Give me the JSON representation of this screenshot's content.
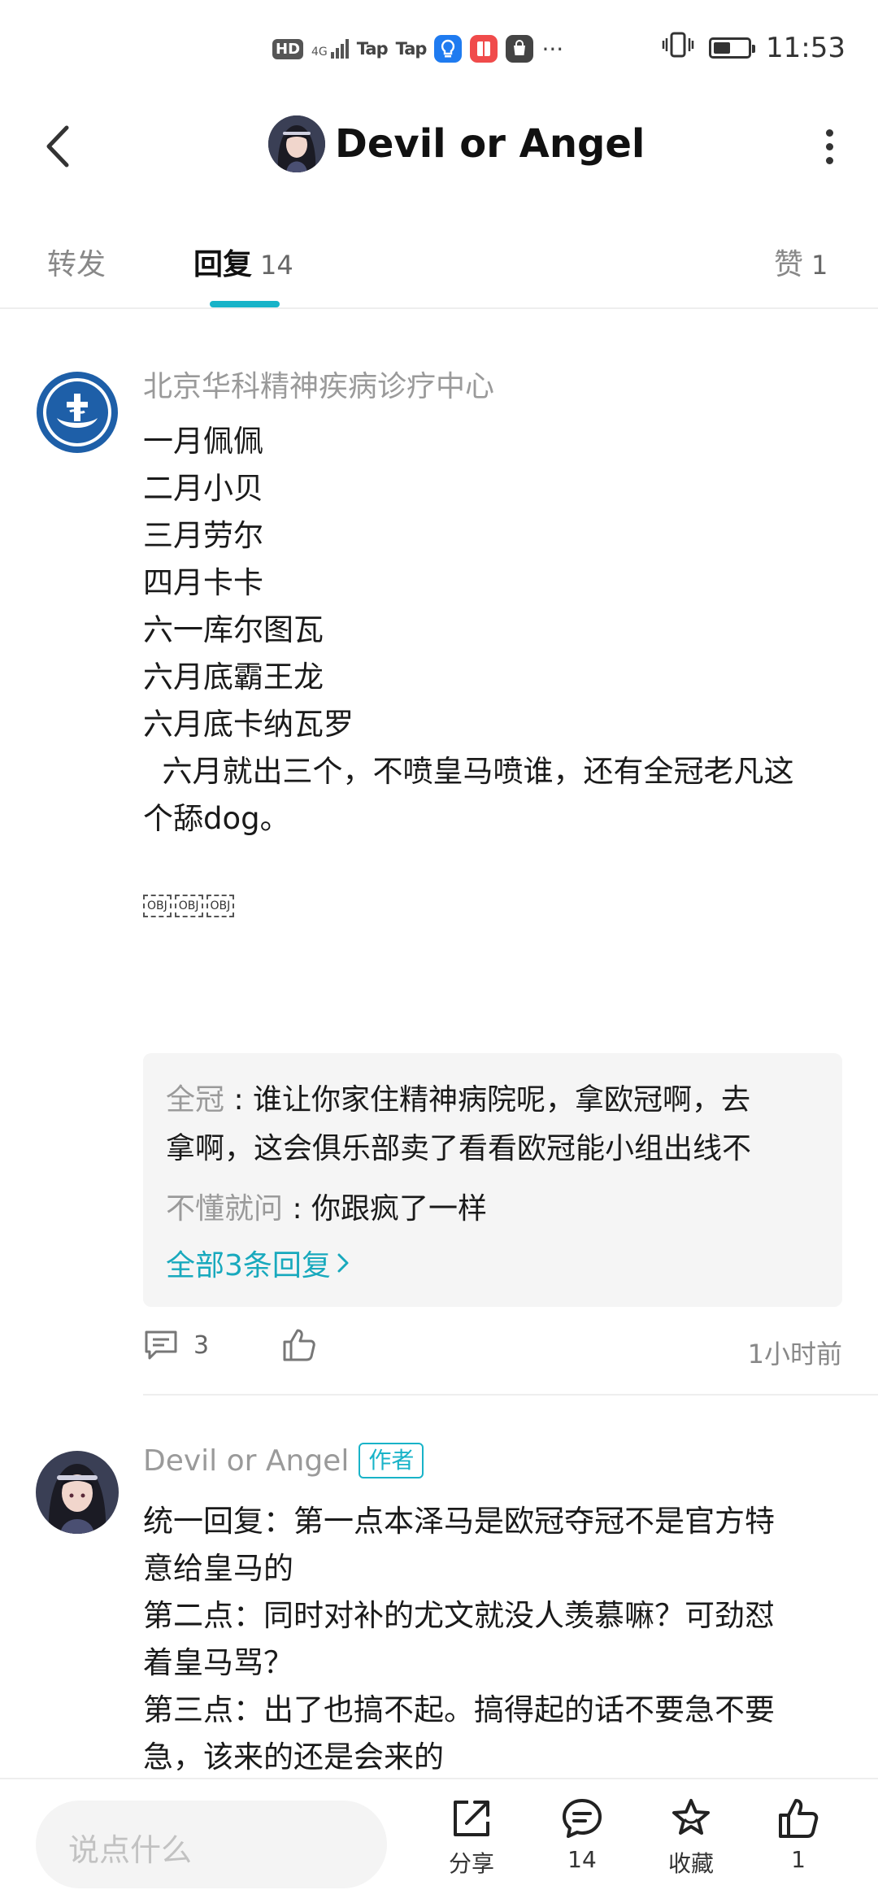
{
  "status_bar": {
    "hd": "HD",
    "network": "4G",
    "tap1": "Tap",
    "tap2": "Tap",
    "more": "···",
    "time": "11:53",
    "battery_level": 0.5
  },
  "header": {
    "title": "Devil or Angel",
    "back_icon": "chevron-left-icon",
    "more_icon": "more-vertical-icon"
  },
  "tabs": [
    {
      "label": "转发",
      "count": ""
    },
    {
      "label": "回复",
      "count": "14"
    },
    {
      "label": "赞",
      "count": "1"
    }
  ],
  "comments": [
    {
      "username": "北京华科精神疾病诊疗中心",
      "lines": [
        "一月佩佩",
        "二月小贝",
        "三月劳尔",
        "四月卡卡",
        "六一库尔图瓦",
        "六月底霸王龙",
        "六月底卡纳瓦罗",
        "  六月就出三个，不喷皇马喷谁，还有全冠老凡这",
        "个舔dog。"
      ],
      "objects": [
        "OBJ",
        "OBJ",
        "OBJ"
      ],
      "replies": [
        {
          "user": "全冠",
          "sep": " : ",
          "text": "谁让你家住精神病院呢，拿欧冠啊，去"
        },
        {
          "user": "",
          "sep": "",
          "text": "拿啊，这会俱乐部卖了看看欧冠能小组出线不"
        },
        {
          "user": "不懂就问",
          "sep": " : ",
          "text": "你跟疯了一样"
        }
      ],
      "all_replies_link": "全部3条回复",
      "reply_count": "3",
      "time": "1小时前"
    },
    {
      "username": "Devil or Angel",
      "badge": "作者",
      "lines": [
        "统一回复：第一点本泽马是欧冠夺冠不是官方特",
        "意给皇马的",
        "第二点：同时对补的尤文就没人羡慕嘛？可劲怼",
        "着皇马骂？",
        "第三点：出了也搞不起。搞得起的话不要急不要",
        "急，该来的还是会来的"
      ]
    }
  ],
  "bottom_bar": {
    "input_placeholder": "说点什么",
    "share_label": "分享",
    "comment_count": "14",
    "favorite_label": "收藏",
    "like_count": "1"
  },
  "colors": {
    "accent": "#18b3c8",
    "link": "#18a9bd",
    "muted": "#9a9a9a"
  }
}
